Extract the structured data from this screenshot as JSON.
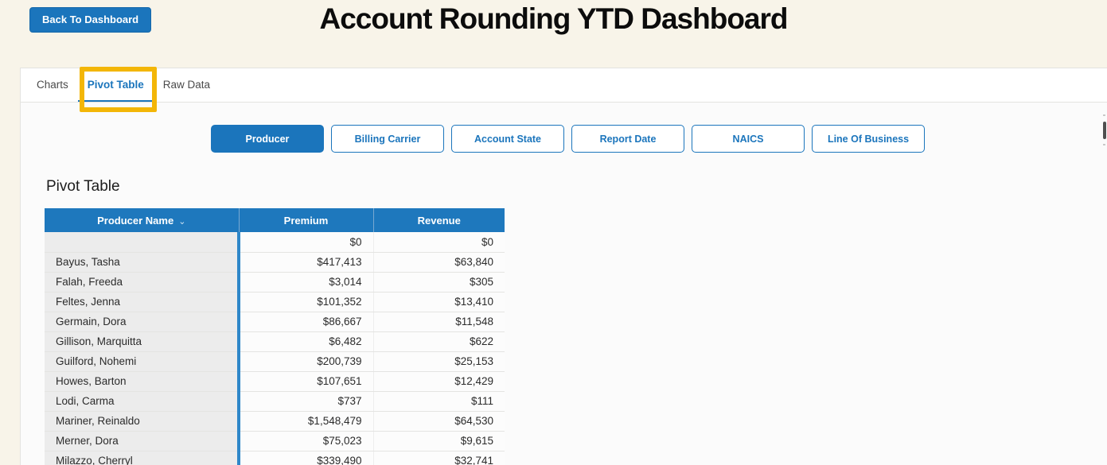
{
  "colors": {
    "accent_blue": "#1b75bc",
    "table_header_blue": "#1e78bd",
    "divider_blue": "#2f87c9",
    "highlight_yellow": "#f3b607",
    "page_background": "#f8f4e9"
  },
  "header": {
    "back_button_label": "Back To Dashboard",
    "title": "Account Rounding YTD Dashboard"
  },
  "tab_bar": {
    "tabs": [
      {
        "label": "Charts",
        "active": false
      },
      {
        "label": "Pivot Table",
        "active": true
      },
      {
        "label": "Raw Data",
        "active": false
      }
    ]
  },
  "filter_buttons": [
    {
      "label": "Producer",
      "active": true
    },
    {
      "label": "Billing Carrier",
      "active": false
    },
    {
      "label": "Account State",
      "active": false
    },
    {
      "label": "Report Date",
      "active": false
    },
    {
      "label": "NAICS",
      "active": false
    },
    {
      "label": "Line Of Business",
      "active": false
    }
  ],
  "pivot_table": {
    "section_title": "Pivot Table",
    "columns": [
      {
        "label": "Producer Name",
        "sort_icon": "⌄"
      },
      {
        "label": "Premium"
      },
      {
        "label": "Revenue"
      }
    ],
    "rows": [
      {
        "name": "",
        "premium": "$0",
        "revenue": "$0"
      },
      {
        "name": "Bayus, Tasha",
        "premium": "$417,413",
        "revenue": "$63,840"
      },
      {
        "name": "Falah, Freeda",
        "premium": "$3,014",
        "revenue": "$305"
      },
      {
        "name": "Feltes, Jenna",
        "premium": "$101,352",
        "revenue": "$13,410"
      },
      {
        "name": "Germain, Dora",
        "premium": "$86,667",
        "revenue": "$11,548"
      },
      {
        "name": "Gillison, Marquitta",
        "premium": "$6,482",
        "revenue": "$622"
      },
      {
        "name": "Guilford, Nohemi",
        "premium": "$200,739",
        "revenue": "$25,153"
      },
      {
        "name": "Howes, Barton",
        "premium": "$107,651",
        "revenue": "$12,429"
      },
      {
        "name": "Lodi, Carma",
        "premium": "$737",
        "revenue": "$111"
      },
      {
        "name": "Mariner, Reinaldo",
        "premium": "$1,548,479",
        "revenue": "$64,530"
      },
      {
        "name": "Merner, Dora",
        "premium": "$75,023",
        "revenue": "$9,615"
      },
      {
        "name": "Milazzo, Cherryl",
        "premium": "$339,490",
        "revenue": "$32,741"
      }
    ]
  }
}
